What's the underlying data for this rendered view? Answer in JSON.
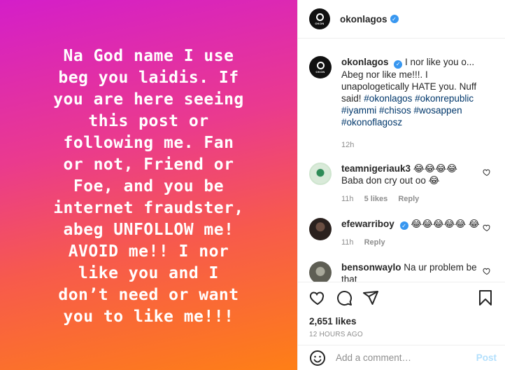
{
  "post": {
    "text": "Na God name I use\nbeg you laidis. If\nyou are here seeing\nthis post or\nfollowing me. Fan\nor not, Friend or\nFoe, and you be\ninternet fraudster,\nabeg UNFOLLOW me!\nAVOID me!! I nor\nlike you and I\ndon’t need or want\nyou to like me!!!",
    "gradient": [
      "#d41ec9",
      "#f75a4c",
      "#fe7f16"
    ]
  },
  "header": {
    "username": "okonlagos",
    "avatar_text": "OKON"
  },
  "caption": {
    "username": "okonlagos",
    "text": "I nor like you o... Abeg nor like me!!!. I unapologetically HATE you. Nuff said!",
    "tags": "#okonlagos #okonrepublic #iyammi #chisos #wosappen #okonoflagosz",
    "time": "12h"
  },
  "comments": [
    {
      "username": "teamnigeriauk3",
      "text": "😂😂😂😂 Baba don cry out oo 😂",
      "time": "11h",
      "likes": "5 likes",
      "reply": "Reply",
      "avatar_color": "#d9ead9"
    },
    {
      "username": "efewarriboy",
      "verified": true,
      "text": "😂😂😂😂😂 😂",
      "time": "11h",
      "reply": "Reply",
      "avatar_color": "#3a2e2a"
    },
    {
      "username": "bensonwaylo",
      "text": "Na ur problem be that",
      "avatar_color": "#7a7a6e"
    }
  ],
  "actions": {
    "likes": "2,651 likes",
    "timestamp": "12 HOURS AGO"
  },
  "add_comment": {
    "placeholder": "Add a comment…",
    "post_label": "Post"
  },
  "colors": {
    "verified": "#3897f0",
    "hashtag": "#00376b",
    "muted": "#8e8e8e",
    "post_button": "#b2dffc"
  }
}
